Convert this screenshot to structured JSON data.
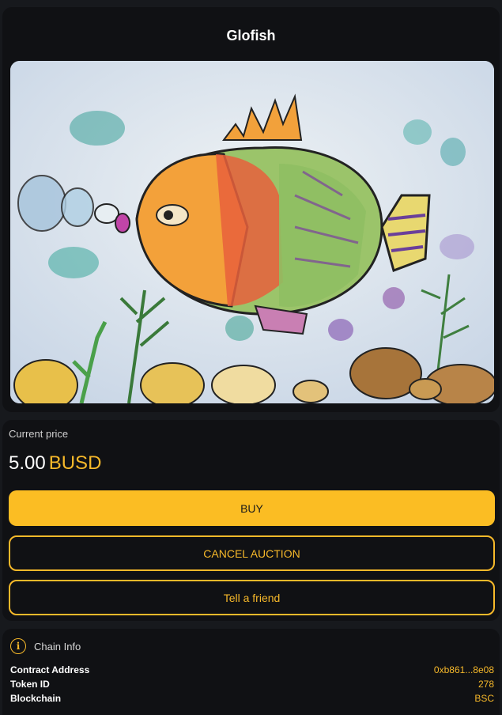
{
  "header": {
    "title": "Glofish"
  },
  "artwork": {
    "subject": "glofish-painting-image"
  },
  "price": {
    "label": "Current price",
    "value": "5.00",
    "currency": "BUSD"
  },
  "actions": {
    "buy": "BUY",
    "cancel_auction": "CANCEL AUCTION",
    "tell_friend": "Tell a friend"
  },
  "chain": {
    "title": "Chain Info",
    "icon": "info-icon",
    "rows": [
      {
        "key": "Contract Address",
        "value": "0xb861...8e08"
      },
      {
        "key": "Token ID",
        "value": "278"
      },
      {
        "key": "Blockchain",
        "value": "BSC"
      }
    ]
  },
  "colors": {
    "accent": "#fbbd23",
    "card": "#101114",
    "background": "#17191d"
  }
}
